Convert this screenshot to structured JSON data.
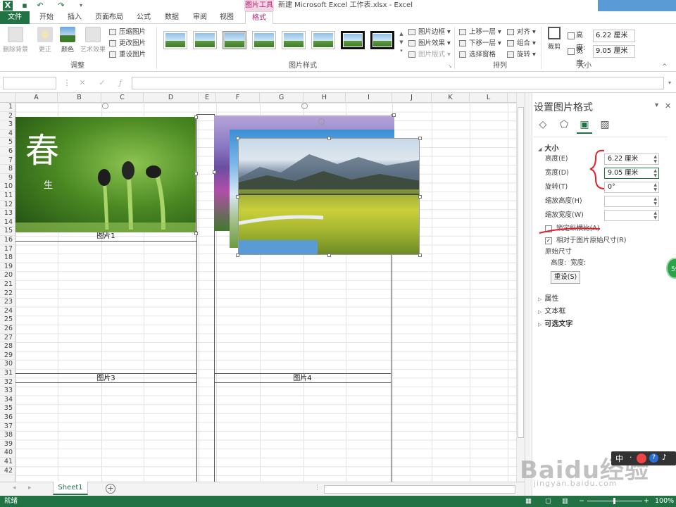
{
  "window": {
    "tool_context": "图片工具",
    "title": "新建 Microsoft Excel 工作表.xlsx - Excel"
  },
  "tabs": [
    {
      "label": "文件",
      "type": "file"
    },
    {
      "label": "开始"
    },
    {
      "label": "插入"
    },
    {
      "label": "页面布局"
    },
    {
      "label": "公式"
    },
    {
      "label": "数据"
    },
    {
      "label": "审阅"
    },
    {
      "label": "视图"
    },
    {
      "label": "格式",
      "active": true
    }
  ],
  "ribbon": {
    "adjust": {
      "remove_bg": "删除背景",
      "correct": "更正",
      "color": "颜色",
      "art_effect": "艺术效果",
      "compress": "压缩图片",
      "change": "更改图片",
      "reset": "重设图片",
      "group_label": "调整"
    },
    "styles": {
      "group_label": "图片样式",
      "border": "图片边框",
      "effect": "图片效果",
      "layout": "图片版式"
    },
    "arrange": {
      "group_label": "排列",
      "bring_forward": "上移一层",
      "send_backward": "下移一层",
      "selection_pane": "选择窗格",
      "align": "对齐",
      "group": "组合",
      "rotate": "旋转"
    },
    "size": {
      "group_label": "大小",
      "crop": "裁剪",
      "height_label": "高度:",
      "height_value": "6.22 厘米",
      "width_label": "宽度:",
      "width_value": "9.05 厘米"
    }
  },
  "grid": {
    "columns": [
      "A",
      "B",
      "C",
      "D",
      "E",
      "F",
      "G",
      "H",
      "I",
      "J",
      "K",
      "L"
    ],
    "rows": [
      "1",
      "2",
      "3",
      "4",
      "5",
      "6",
      "7",
      "8",
      "9",
      "10",
      "11",
      "12",
      "13",
      "14",
      "15",
      "16",
      "17",
      "18",
      "19",
      "20",
      "21",
      "22",
      "23",
      "24",
      "25",
      "26",
      "27",
      "28",
      "29",
      "30",
      "31",
      "32",
      "33",
      "34",
      "35",
      "36",
      "37",
      "38",
      "39",
      "40",
      "41",
      "42"
    ],
    "captions": {
      "pic1": "图片1",
      "pic3": "图片3",
      "pic4": "图片4"
    },
    "spring_char": "春",
    "spring_sub": "生"
  },
  "sheet_tabs": {
    "active": "Sheet1"
  },
  "status": {
    "ready": "就绪",
    "zoom": "100%"
  },
  "pane": {
    "title": "设置图片格式",
    "size_section": "大小",
    "height_label": "高度(E)",
    "height_value": "6.22 厘米",
    "width_label": "宽度(D)",
    "width_value": "9.05 厘米",
    "rotate_label": "旋转(T)",
    "rotate_value": "0°",
    "scale_h_label": "缩放高度(H)",
    "scale_w_label": "缩放宽度(W)",
    "lock_ratio": "锁定纵横比(A)",
    "relative_original": "相对于图片原始尺寸(R)",
    "original_size": "原始尺寸",
    "orig_height": "高度:",
    "orig_width": "宽度:",
    "reset": "重设(S)",
    "properties": "属性",
    "textbox": "文本框",
    "alt_text": "可选文字"
  },
  "watermark": {
    "main": "Baidu经验",
    "sub": "jingyan.baidu.com"
  },
  "colors": {
    "excel_green": "#217346",
    "accent_blue": "#5b9bd5",
    "annotation_red": "#e0202a"
  }
}
